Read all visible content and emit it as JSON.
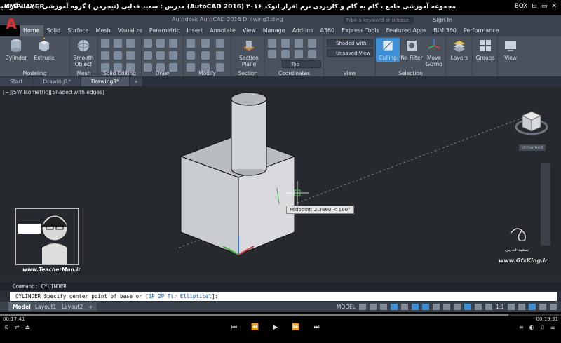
{
  "player": {
    "logo": "KMPLAYER",
    "title": "مجموعه آموزشی جامع ، گام به گام و کاربردی نرم افزار  اتوکد ۲۰۱۶  (AutoCAD 2016)  مدرس : سعید فدایی (تیچرمن ) گروه آموزشی پادشاه گرافیست ها",
    "window_controls": [
      "BOX",
      "⊟",
      "▭",
      "✕"
    ],
    "time_elapsed": "00:17:41",
    "time_total": "00:19:31",
    "progress_fraction": 0.906,
    "left_buttons": [
      "⊙",
      "⇌",
      "⏏"
    ],
    "controls": [
      "⏮",
      "⏪",
      "▶",
      "⏩",
      "⏭"
    ],
    "right_buttons": [
      "≡",
      "◐",
      "♫",
      "☰"
    ]
  },
  "acad": {
    "app_letter": "A",
    "window_title": "Autodesk AutoCAD 2016     Drawing3.dwg",
    "search_placeholder": "Type a keyword or phrase",
    "signin": "Sign In",
    "ribbon_tabs": [
      "Home",
      "Solid",
      "Surface",
      "Mesh",
      "Visualize",
      "Parametric",
      "Insert",
      "Annotate",
      "View",
      "Manage",
      "Add-ins",
      "A360",
      "Express Tools",
      "Featured Apps",
      "BIM 360",
      "Performance"
    ],
    "active_tab": "Home",
    "panels": {
      "modeling": "Modeling",
      "mesh": "Mesh",
      "solid_editing": "Solid Editing",
      "draw": "Draw",
      "modify": "Modify",
      "section": "Section",
      "coordinates": "Coordinates",
      "view": "View",
      "selection": "Selection"
    },
    "buttons": {
      "cylinder": "Cylinder",
      "extrude": "Extrude",
      "smooth_object": "Smooth Object",
      "section_plane": "Section Plane",
      "culling": "Culling",
      "no_filter": "No Filter",
      "move_gizmo": "Move Gizmo",
      "layers": "Layers",
      "groups": "Groups",
      "view": "View"
    },
    "dropdowns": {
      "visual_style": "Shaded with e...",
      "saved_view": "Unsaved View",
      "view_dir": "Top"
    },
    "file_tabs": [
      "Start",
      "Drawing1*",
      "Drawing3*"
    ],
    "active_file_tab": "Drawing3*",
    "viewport_label": "[−][SW Isometric][Shaded with edges]",
    "viewcube_label": "Unnamed",
    "tooltip": "Midpoint: 2.3660 < 180°",
    "command_history": "Command:  CYLINDER",
    "command_prompt_prefix": "CYLINDER Specify center point of base or [",
    "command_options": [
      "3P",
      "2P",
      "Ttr",
      "Elliptical"
    ],
    "command_prompt_suffix": "]:",
    "layout_tabs": [
      "Model",
      "Layout1",
      "Layout2"
    ],
    "active_layout": "Model",
    "status_model": "MODEL",
    "status_scale": "1:1"
  },
  "watermarks": {
    "teacherman_url": "www.TeacherMan.ir",
    "gfx_url": "www.GfxKing.ir",
    "gfx_signature": "سعید فدایی"
  },
  "colors": {
    "ribbon_bg": "#4a525e",
    "viewport_bg": "#26292e",
    "accent_blue": "#3d8fd8",
    "autocad_red": "#e03030"
  }
}
